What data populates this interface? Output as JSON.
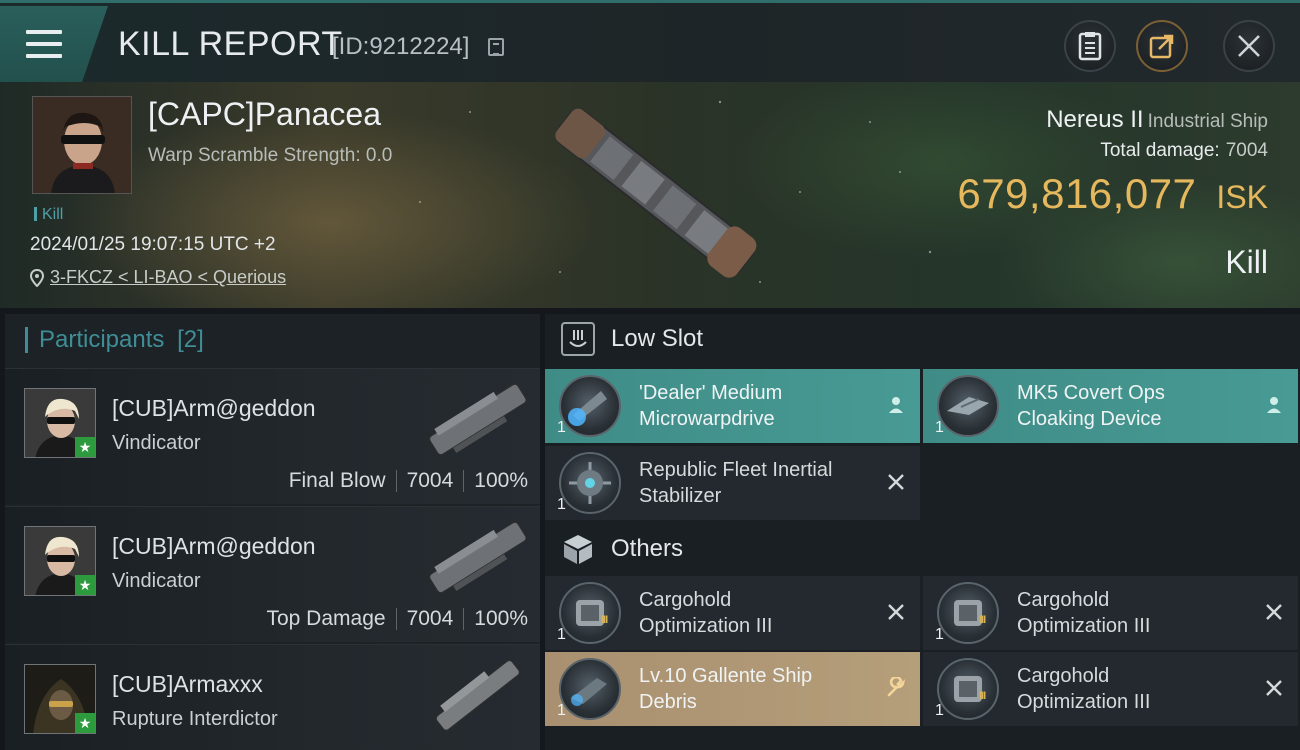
{
  "header": {
    "title": "KILL REPORT",
    "report_id": "[ID:9212224]"
  },
  "victim": {
    "name": "[CAPC]Panacea",
    "warp_scramble": "Warp Scramble Strength: 0.0",
    "tag": "Kill",
    "datetime": "2024/01/25 19:07:15 UTC +2",
    "location": "3-FKCZ < LI-BAO < Querious",
    "ship_name": "Nereus II",
    "ship_class": "Industrial Ship",
    "total_damage_label": "Total damage:",
    "total_damage": "7004",
    "isk_value": "679,816,077",
    "isk_unit": "ISK",
    "result": "Kill"
  },
  "participants": {
    "title": "Participants",
    "count": "[2]",
    "rows": [
      {
        "name": "[CUB]Arm@geddon",
        "ship": "Vindicator",
        "role": "Final Blow",
        "damage": "7004",
        "percent": "100%"
      },
      {
        "name": "[CUB]Arm@geddon",
        "ship": "Vindicator",
        "role": "Top Damage",
        "damage": "7004",
        "percent": "100%"
      },
      {
        "name": "[CUB]Armaxxx",
        "ship": "Rupture Interdictor"
      }
    ]
  },
  "low_slot": {
    "title": "Low Slot",
    "modules": [
      {
        "name_line1": "'Dealer' Medium",
        "name_line2": "Microwarpdrive",
        "qty": "1",
        "status": "person-icon"
      },
      {
        "name_line1": "MK5 Covert Ops",
        "name_line2": "Cloaking Device",
        "qty": "1",
        "status": "person-icon"
      },
      {
        "name_line1": "Republic Fleet Inertial",
        "name_line2": "Stabilizer",
        "qty": "1",
        "status": "x-icon"
      }
    ]
  },
  "others": {
    "title": "Others",
    "modules": [
      {
        "name_line1": "Cargohold",
        "name_line2": "Optimization III",
        "qty": "1",
        "status": "x-icon"
      },
      {
        "name_line1": "Cargohold",
        "name_line2": "Optimization III",
        "qty": "1",
        "status": "x-icon"
      },
      {
        "name_line1": "Lv.10 Gallente Ship",
        "name_line2": "Debris",
        "qty": "1",
        "status": "wrench-icon"
      },
      {
        "name_line1": "Cargohold",
        "name_line2": "Optimization III",
        "qty": "1",
        "status": "x-icon"
      }
    ]
  },
  "colors": {
    "accent_teal": "#3f8c87",
    "isk_gold": "#e6b85e",
    "highlight_gold": "#a99070"
  }
}
